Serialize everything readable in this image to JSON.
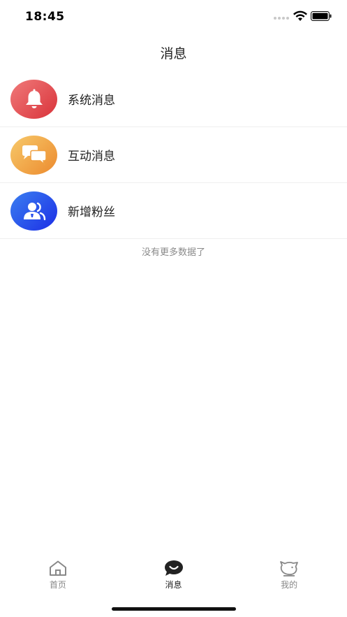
{
  "status_bar": {
    "time": "18:45"
  },
  "nav": {
    "title": "消息"
  },
  "messages": [
    {
      "label": "系统消息",
      "icon": "bell-icon",
      "color": "#e04a4f"
    },
    {
      "label": "互动消息",
      "icon": "chat-bubbles-icon",
      "color": "#f0a040"
    },
    {
      "label": "新增粉丝",
      "icon": "users-icon",
      "color": "#2a50ec"
    }
  ],
  "list_footer": "没有更多数据了",
  "tabs": [
    {
      "label": "首页",
      "icon": "home-icon",
      "active": false
    },
    {
      "label": "消息",
      "icon": "message-icon",
      "active": true
    },
    {
      "label": "我的",
      "icon": "pig-icon",
      "active": false
    }
  ]
}
